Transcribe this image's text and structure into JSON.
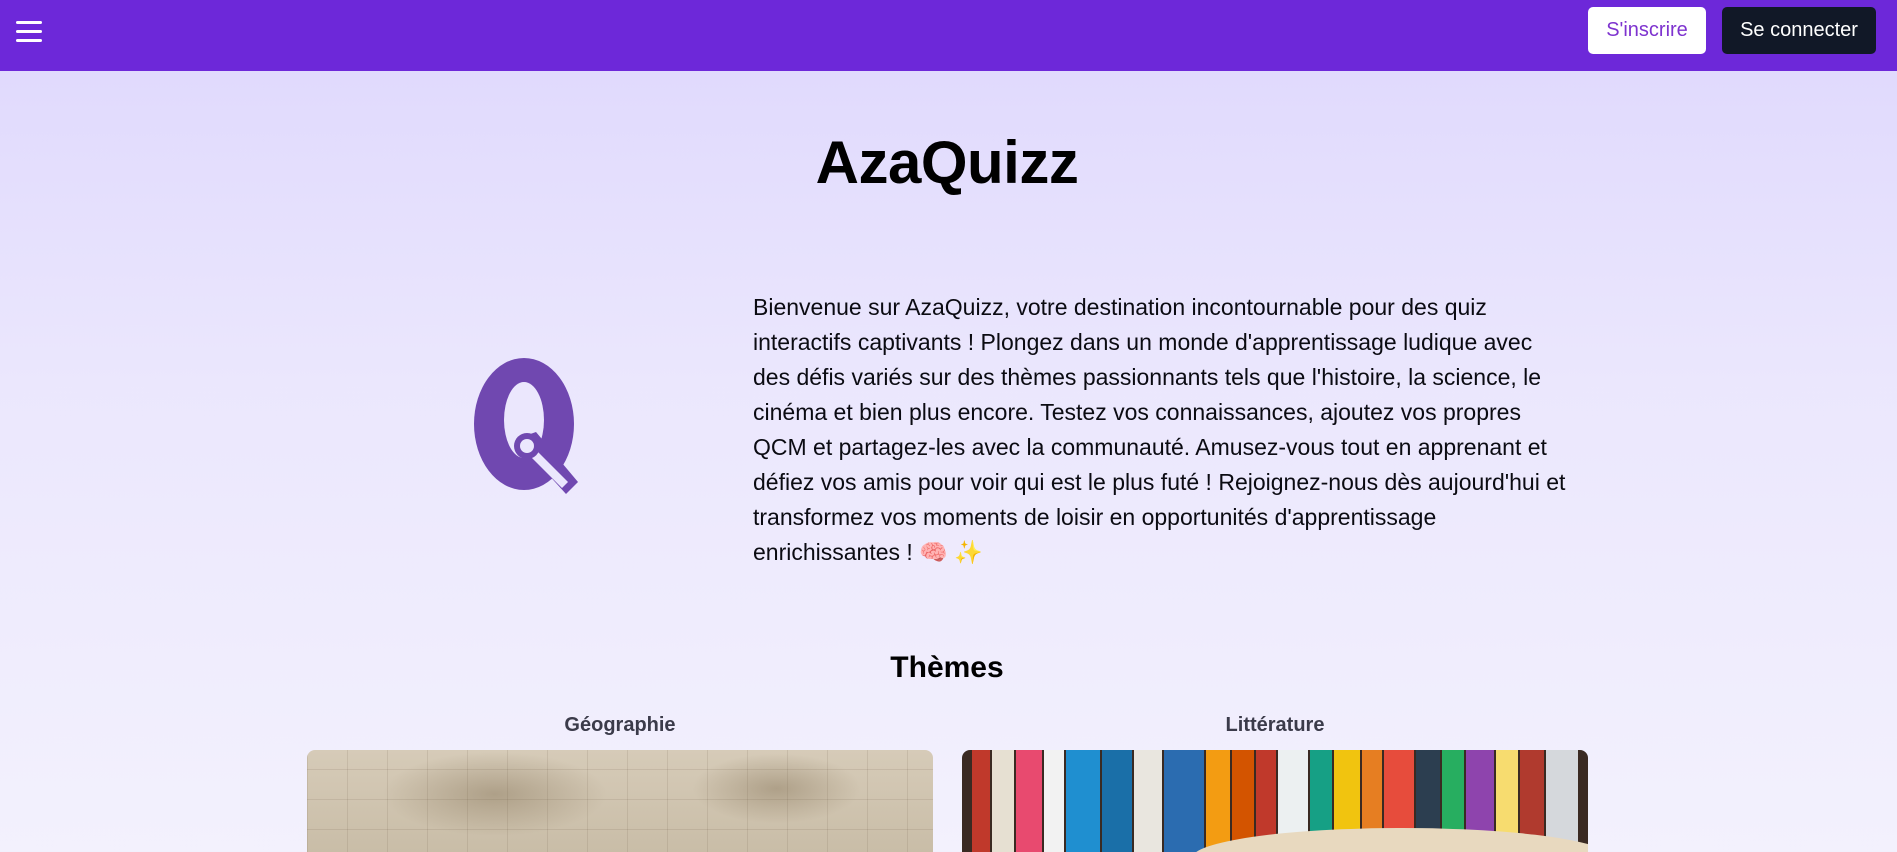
{
  "nav": {
    "menu_icon": "hamburger-menu-icon",
    "signup_label": "S'inscrire",
    "login_label": "Se connecter"
  },
  "hero": {
    "title": "AzaQuizz",
    "logo_letter": "Q",
    "intro": "Bienvenue sur AzaQuizz, votre destination incontournable pour des quiz interactifs captivants ! Plongez dans un monde d'apprentissage ludique avec des défis variés sur des thèmes passionnants tels que l'histoire, la science, le cinéma et bien plus encore. Testez vos connaissances, ajoutez vos propres QCM et partagez-les avec la communauté. Amusez-vous tout en apprenant et défiez vos amis pour voir qui est le plus futé ! Rejoignez-nous dès aujourd'hui et transformez vos moments de loisir en opportunités d'apprentissage enrichissantes ! 🧠 ✨"
  },
  "themes": {
    "heading": "Thèmes",
    "items": [
      {
        "label": "Géographie",
        "image": "world-map-image"
      },
      {
        "label": "Littérature",
        "image": "bookshelf-image"
      }
    ]
  },
  "colors": {
    "navbar": "#6d28d9",
    "logo": "#7048b0",
    "login_button": "#111827",
    "signup_text": "#7e33cf"
  }
}
